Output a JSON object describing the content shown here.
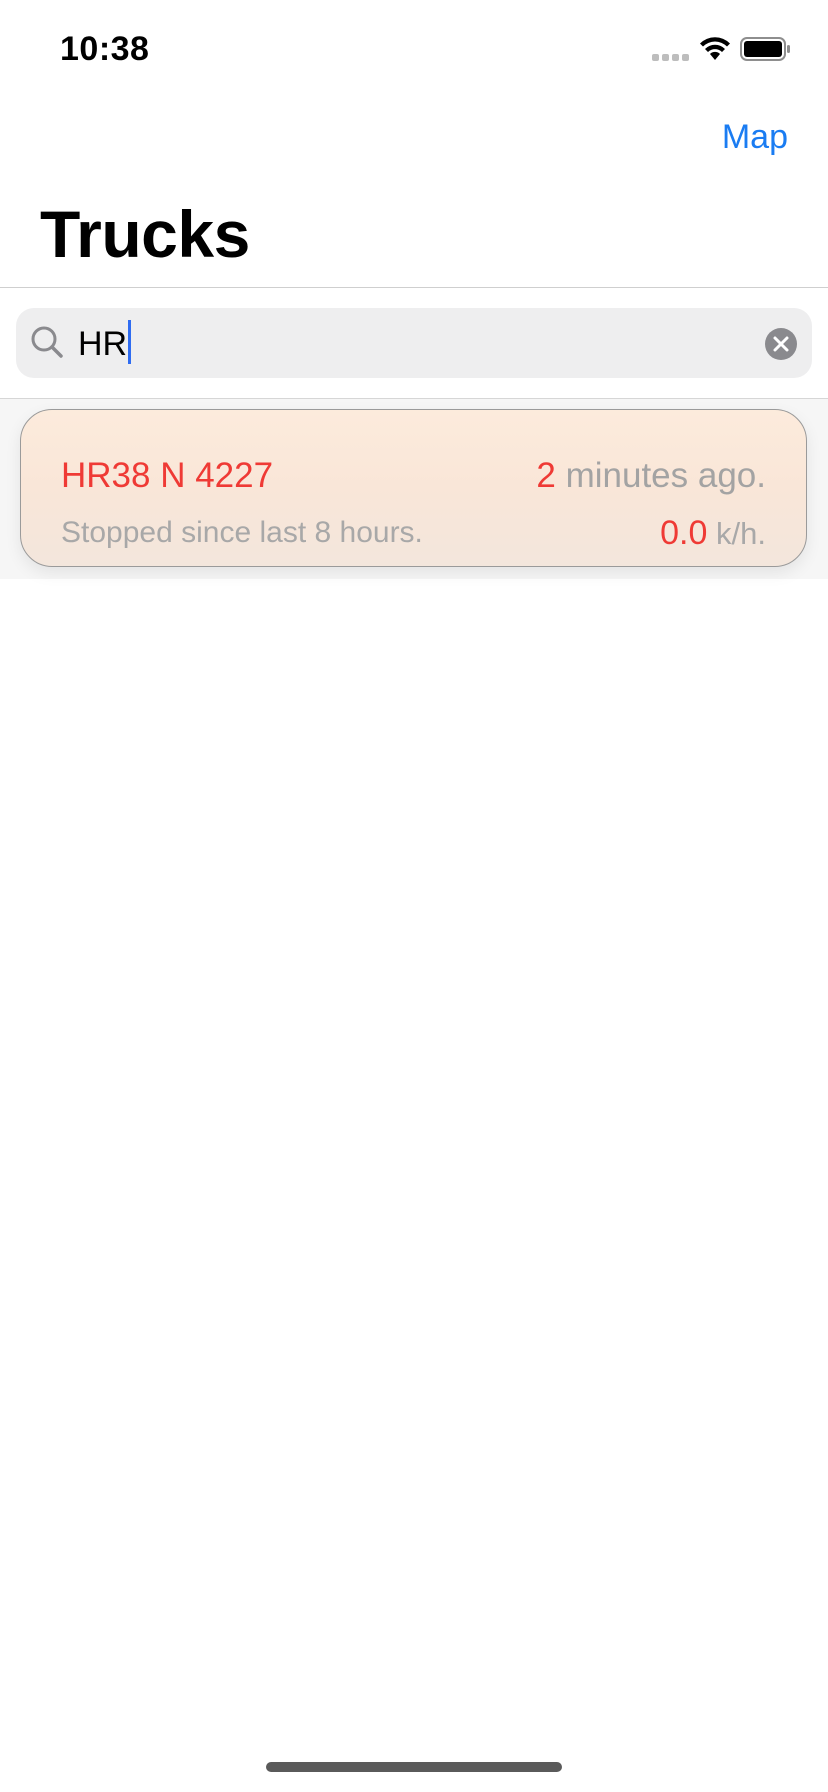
{
  "status_bar": {
    "time": "10:38",
    "icons": [
      "cellular-signal-icon",
      "wifi-icon",
      "battery-icon"
    ]
  },
  "nav": {
    "map_label": "Map",
    "title": "Trucks"
  },
  "search": {
    "value": "HR",
    "icon": "search-icon",
    "clear_icon": "clear-icon"
  },
  "trucks": [
    {
      "id": "HR38 N 4227",
      "time_value": "2",
      "time_suffix": " minutes ago.",
      "status": "Stopped since last 8 hours.",
      "speed_value": "0.0",
      "speed_unit": " k/h."
    }
  ],
  "colors": {
    "accent_blue": "#1a7cf2",
    "alert_red": "#ef3a35",
    "card_bg": "#fcebdc"
  }
}
